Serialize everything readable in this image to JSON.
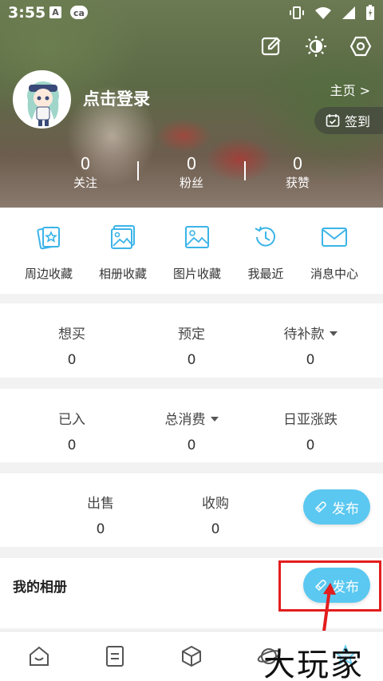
{
  "status_bar": {
    "time": "3:55"
  },
  "profile": {
    "login_label": "点击登录",
    "home_link": "主页 >",
    "checkin_label": "签到"
  },
  "stats": [
    {
      "value": "0",
      "label": "关注"
    },
    {
      "value": "0",
      "label": "粉丝"
    },
    {
      "value": "0",
      "label": "获赞"
    }
  ],
  "quick_actions": [
    {
      "label": "周边收藏",
      "icon": "card-star-icon"
    },
    {
      "label": "相册收藏",
      "icon": "album-icon"
    },
    {
      "label": "图片收藏",
      "icon": "image-icon"
    },
    {
      "label": "我最近",
      "icon": "history-icon"
    },
    {
      "label": "消息中心",
      "icon": "mail-icon"
    }
  ],
  "orders_row1": [
    {
      "label": "想买",
      "value": "0"
    },
    {
      "label": "预定",
      "value": "0"
    },
    {
      "label": "待补款",
      "value": "0"
    }
  ],
  "orders_row2": [
    {
      "label": "已入",
      "value": "0"
    },
    {
      "label": "总消费",
      "value": "0"
    },
    {
      "label": "日亚涨跌",
      "value": "0"
    }
  ],
  "trade": [
    {
      "label": "出售",
      "value": "0"
    },
    {
      "label": "收购",
      "value": "0"
    }
  ],
  "publish_label": "发布",
  "album_title": "我的相册",
  "watermark": "大玩家",
  "colors": {
    "accent": "#5ac8f0",
    "highlight": "#e31d1d"
  }
}
